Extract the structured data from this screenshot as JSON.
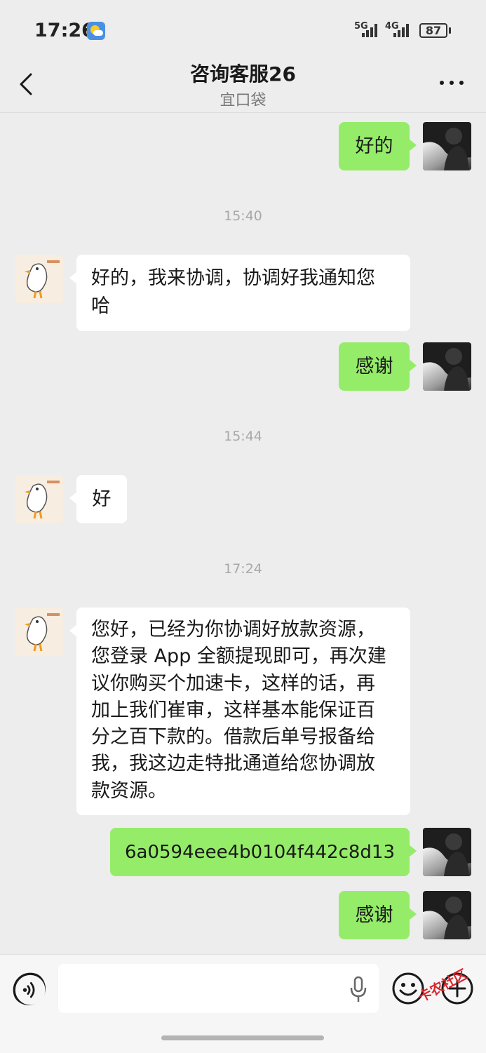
{
  "status_bar": {
    "time": "17:26",
    "net1": "5G",
    "net2": "4G",
    "battery": "87"
  },
  "header": {
    "title": "咨询客服26",
    "subtitle": "宜口袋"
  },
  "messages": [
    {
      "sender": "me",
      "text": "好的"
    },
    {
      "timestamp": "15:40"
    },
    {
      "sender": "them",
      "text": "好的，我来协调，协调好我通知您哈"
    },
    {
      "sender": "me",
      "text": "感谢"
    },
    {
      "timestamp": "15:44"
    },
    {
      "sender": "them",
      "text": "好"
    },
    {
      "timestamp": "17:24"
    },
    {
      "sender": "them",
      "text": "您好，已经为你协调好放款资源，您登录 App 全额提现即可，再次建议你购买个加速卡，这样的话，再加上我们崔审，这样基本能保证百分之百下款的。借款后单号报备给我，我这边走特批通道给您协调放款资源。"
    },
    {
      "sender": "me",
      "text": "6a0594eee4b0104f442c8d13"
    },
    {
      "sender": "me",
      "text": "感谢"
    }
  ],
  "lines": {
    "m2": [
      "好的，我来协调，协调好我通知您",
      "哈"
    ],
    "m7": [
      "您好，已经为你协调好放款资源，",
      "您登录 App 全额提现即可，再次建",
      "议你购买个加速卡，这样的话，再",
      "加上我们崔审，这样基本能保证百",
      "分之百下款的。借款后单号报备给",
      "我，我这边走特批通道给您协调放",
      "款资源。"
    ]
  },
  "watermark": "卡农社区",
  "colors": {
    "background": "#ededed",
    "my_bubble": "#95ec69",
    "their_bubble": "#ffffff",
    "timestamp": "#a8a8a8"
  },
  "icons": {
    "back": "chevron-left-icon",
    "more": "more-dots-icon",
    "voice": "voice-icon",
    "mic": "microphone-icon",
    "emoji": "emoji-icon",
    "plus": "plus-icon"
  }
}
